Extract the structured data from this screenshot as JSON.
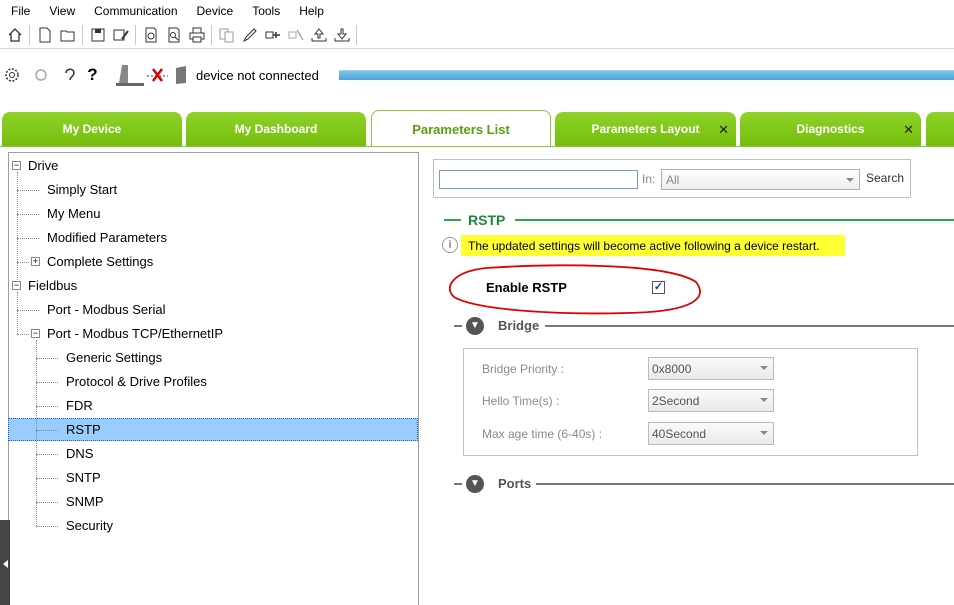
{
  "menu": [
    "File",
    "View",
    "Communication",
    "Device",
    "Tools",
    "Help"
  ],
  "status": {
    "text": "device not connected"
  },
  "tabs": [
    {
      "label": "My Device",
      "closable": false
    },
    {
      "label": "My Dashboard",
      "closable": false
    },
    {
      "label": "Parameters List",
      "closable": false,
      "active": true
    },
    {
      "label": "Parameters Layout",
      "closable": true
    },
    {
      "label": "Diagnostics",
      "closable": true
    }
  ],
  "tree": {
    "drive": "Drive",
    "simply_start": "Simply Start",
    "my_menu": "My Menu",
    "modified_parameters": "Modified Parameters",
    "complete_settings": "Complete Settings",
    "fieldbus": "Fieldbus",
    "port_modbus_serial": "Port - Modbus Serial",
    "port_modbus_tcp": "Port - Modbus TCP/EthernetIP",
    "generic_settings": "Generic Settings",
    "protocol_drive_profiles": "Protocol & Drive Profiles",
    "fdr": "FDR",
    "rstp": "RSTP",
    "dns": "DNS",
    "sntp": "SNTP",
    "snmp": "SNMP",
    "security": "Security"
  },
  "search": {
    "value": "",
    "in_label": "In:",
    "in_selected": "All",
    "button": "Search"
  },
  "rstp": {
    "title": "RSTP",
    "info": "The updated settings will become active following a device restart.",
    "enable_label": "Enable RSTP",
    "enable_checked": "✓"
  },
  "bridge": {
    "title": "Bridge",
    "priority_label": "Bridge Priority :",
    "priority_value": "0x8000",
    "hello_label": "Hello Time(s) :",
    "hello_value": "2Second",
    "maxage_label": "Max age time (6-40s) :",
    "maxage_value": "40Second"
  },
  "ports": {
    "title": "Ports"
  },
  "colors": {
    "tab_green": "#7fc41a",
    "accent_green": "#2aa84a",
    "selection": "#99ccff",
    "highlight": "#ffff33",
    "annotation_red": "#e00000"
  }
}
